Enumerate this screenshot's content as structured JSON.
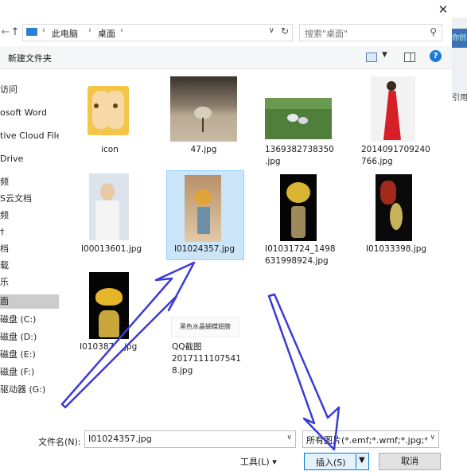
{
  "title_bar": {
    "close_glyph": "✕"
  },
  "address": {
    "crumbs": [
      "此电脑",
      "桌面"
    ],
    "search_placeholder": "搜索\"桌面\""
  },
  "bg_app": {
    "ribbon_text": "你创",
    "label": "引用"
  },
  "toolbar": {
    "new_folder": "新建文件夹",
    "help": "?"
  },
  "sidebar": {
    "items": [
      "访问",
      "osoft Word",
      "tive Cloud Files",
      "Drive",
      "频",
      "S云文档",
      "频",
      "†",
      "档",
      "载",
      "乐",
      "面",
      "磁盘 (C:)",
      "磁盘 (D:)",
      "磁盘 (E:)",
      "磁盘 (F:)",
      "驱动器 (G:)"
    ]
  },
  "files": [
    {
      "name": "icon"
    },
    {
      "name": "47.jpg"
    },
    {
      "name": "1369382738350",
      "name2": ".jpg"
    },
    {
      "name": "2014091709240",
      "name2": "766.jpg"
    },
    {
      "name": "I00013601.jpg"
    },
    {
      "name": "I01024357.jpg"
    },
    {
      "name": "I01031724_1498",
      "name2": "631998924.jpg"
    },
    {
      "name": "I01033398.jpg"
    },
    {
      "name": "I01038725.jpg",
      "shown": "I010387",
      "shown2": "jpg"
    },
    {
      "name": "QQ截图",
      "name2": "2017111107541",
      "name3": "8.jpg",
      "thumb_text": "黑色水晶蝴蝶翅膀"
    }
  ],
  "bottom": {
    "filename_label": "文件名(N):",
    "filename_value": "I01024357.jpg",
    "filter_value": "所有图片(*.emf;*.wmf;*.jpg;*.jp",
    "tools": "工具(L)",
    "insert": "插入(S)",
    "cancel": "取消"
  },
  "colors": {
    "accent": "#0078d7",
    "selection": "#cce4f7",
    "arrow": "#3b3bd6"
  }
}
